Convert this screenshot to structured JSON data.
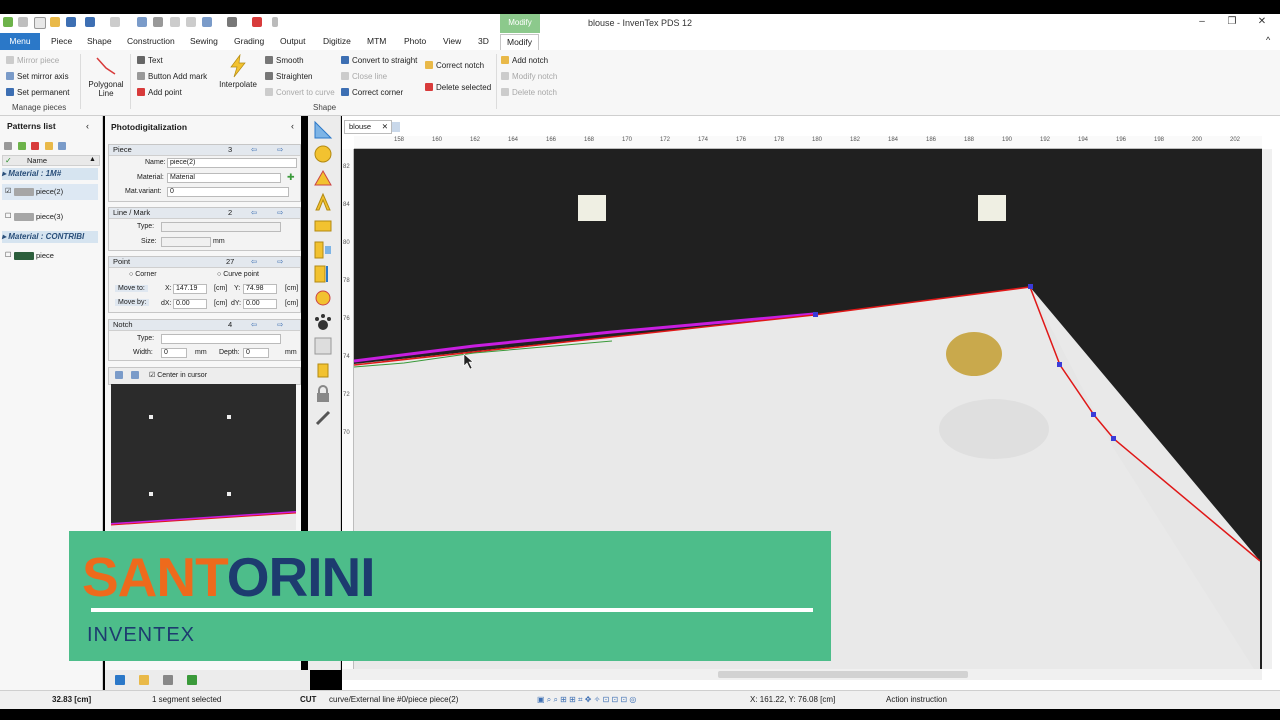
{
  "app": {
    "title": "blouse - InvenTex PDS 12",
    "context_tab": "Modify"
  },
  "tabs": {
    "menu": "Menu",
    "items": [
      "Piece",
      "Shape",
      "Construction",
      "Sewing",
      "Grading",
      "Output",
      "Digitize",
      "MTM",
      "Photo",
      "View",
      "3D"
    ],
    "active": "Modify"
  },
  "ribbon": {
    "manage": {
      "mirror_piece": "Mirror piece",
      "set_mirror_axis": "Set mirror axis",
      "set_permanent": "Set permanent",
      "label": "Manage pieces"
    },
    "polygonal": "Polygonal Line",
    "text_tools": {
      "text": "Text",
      "button_add_mark": "Button Add mark",
      "add_point": "Add point"
    },
    "interpolate": "Interpolate",
    "shape_tools": {
      "smooth": "Smooth",
      "straighten": "Straighten",
      "convert_to_curve": "Convert to curve",
      "convert_to_straight": "Convert to straight",
      "close_line": "Close line",
      "correct_corner": "Correct corner"
    },
    "shape_label": "Shape",
    "notch_tools": {
      "correct_notch": "Correct notch",
      "delete_selected": "Delete selected",
      "add_notch": "Add notch",
      "modify_notch": "Modify notch",
      "delete_notch": "Delete notch"
    }
  },
  "patterns": {
    "title": "Patterns list",
    "col_name": "Name",
    "materials": [
      {
        "label": "Material : 1M#",
        "pieces": [
          "piece(2)",
          "piece(3)"
        ]
      },
      {
        "label": "Material : CONTRIBI",
        "pieces": [
          "piece"
        ]
      }
    ]
  },
  "photo": {
    "title": "Photodigitalization",
    "piece": {
      "label": "Piece",
      "index": "3",
      "name_label": "Name:",
      "name": "piece(2)",
      "material_label": "Material:",
      "material": "Material",
      "matvariant_label": "Mat.variant:",
      "matvariant": "0"
    },
    "line": {
      "label": "Line / Mark",
      "index": "2",
      "type_label": "Type:",
      "size_label": "Size:",
      "size_unit": "mm"
    },
    "point": {
      "label": "Point",
      "index": "27",
      "corner": "Corner",
      "curve": "Curve point",
      "move_to": "Move to:",
      "x_label": "X:",
      "x": "147.19",
      "y_label": "Y:",
      "y": "74.98",
      "unit": "[cm]",
      "move_by": "Move by:",
      "dx_label": "dX:",
      "dx": "0.00",
      "dy_label": "dY:",
      "dy": "0.00"
    },
    "notch": {
      "label": "Notch",
      "index": "4",
      "type_label": "Type:",
      "width_label": "Width:",
      "width": "0",
      "depth_label": "Depth:",
      "depth": "0",
      "unit": "mm"
    },
    "preview": {
      "center_label": "Center in cursor"
    }
  },
  "canvas": {
    "doc_tab": "blouse",
    "ruler_h": [
      "158",
      "160",
      "162",
      "164",
      "166",
      "168",
      "170",
      "172",
      "174",
      "176",
      "178",
      "180",
      "182",
      "184",
      "186",
      "188",
      "190",
      "192",
      "194",
      "196",
      "198",
      "200",
      "202"
    ],
    "ruler_v": [
      "82",
      "84",
      "80",
      "78",
      "76",
      "74",
      "72",
      "70"
    ]
  },
  "banner": {
    "title_part1": "SANT",
    "title_part2": "ORINI",
    "subtitle": "INVENTEX"
  },
  "status": {
    "value": "32.83 [cm]",
    "selected": "1 segment selected",
    "mode": "CUT",
    "curve": "curve/External line #0/piece piece(2)",
    "coords": "X: 161.22, Y: 76.08 [cm]",
    "action": "Action instruction"
  },
  "colors": {
    "accent": "#2b78c8",
    "banner": "#4dbd8a",
    "orange": "#ee6a1c",
    "navy": "#1d3b6f",
    "outline": "#e01818",
    "selection": "#c81ee0"
  }
}
